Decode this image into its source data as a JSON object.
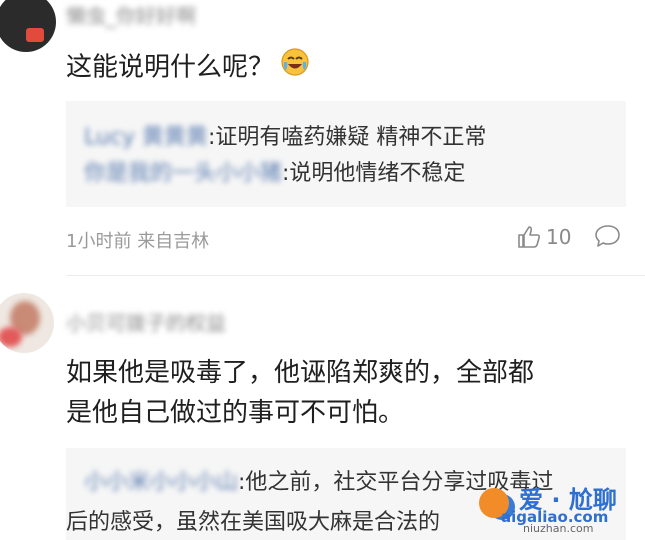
{
  "comments": [
    {
      "username": "懒虫_你好好啊",
      "text": "这能说明什么呢？",
      "emoji": "laughing-crying-emoji",
      "replies": [
        {
          "user": "Lucy 黄黄黄",
          "text": ":证明有嗑药嫌疑 精神不正常"
        },
        {
          "user": "你是我的一头小小猪",
          "text": ":说明他情绪不稳定"
        }
      ],
      "time": "1小时前",
      "location": "来自吉林",
      "likes": "10"
    },
    {
      "username": "小贝可拨子的权益",
      "text_lines": [
        "如果他是吸毒了，他诬陷郑爽的，全部都",
        "是他自己做过的事可不可怕。"
      ],
      "replies": [
        {
          "user": "小小米小小小山",
          "text_lines": [
            ":他之前，社交平台分享过吸毒过",
            "后的感受，虽然在美国吸大麻是合法的"
          ]
        }
      ]
    }
  ],
  "watermark": {
    "top": "爱 · 尬聊",
    "site": "aigaliao.com",
    "sub": "niuzhan.com"
  },
  "colors": {
    "reply_user": "#5b7db1",
    "reply_bg": "#f6f6f6",
    "meta": "#9a9a9a"
  }
}
